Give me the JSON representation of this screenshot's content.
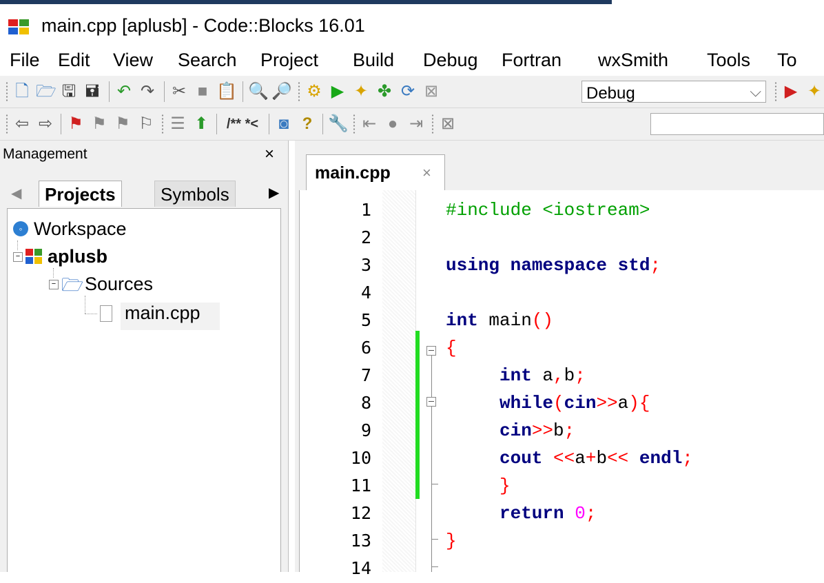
{
  "window": {
    "title": "main.cpp [aplusb] - Code::Blocks 16.01",
    "accent_color": "#1f3a5f"
  },
  "menubar": {
    "items": [
      "File",
      "Edit",
      "View",
      "Search",
      "Project",
      "Build",
      "Debug",
      "Fortran",
      "wxSmith",
      "Tools",
      "To"
    ]
  },
  "toolbar1": {
    "icons": [
      "new-file-icon",
      "open-icon",
      "save-icon",
      "save-all-icon",
      "undo-icon",
      "redo-icon",
      "cut-icon",
      "copy-icon",
      "paste-icon",
      "find-icon",
      "replace-icon",
      "build-icon",
      "run-icon",
      "build-and-run-icon",
      "rebuild-icon",
      "abort-icon"
    ],
    "build_target": "Debug",
    "debug_icons": [
      "debug-continue-icon"
    ]
  },
  "toolbar2": {
    "icons": [
      "jump-back-icon",
      "jump-forward-icon",
      "toggle-bookmark-icon",
      "prev-bookmark-icon",
      "next-bookmark-icon",
      "clear-bookmarks-icon",
      "highlight-icon",
      "match-icon"
    ],
    "doxygen_label": "/** *<",
    "search_value": ""
  },
  "management": {
    "title": "Management",
    "close": "×",
    "tabs": [
      "Projects",
      "Symbols"
    ],
    "active_tab": "Projects",
    "tree": {
      "workspace": "Workspace",
      "project": "aplusb",
      "folder": "Sources",
      "file": "main.cpp"
    }
  },
  "editor": {
    "tab_label": "main.cpp",
    "tab_close": "×",
    "line_numbers": [
      "1",
      "2",
      "3",
      "4",
      "5",
      "6",
      "7",
      "8",
      "9",
      "10",
      "11",
      "12",
      "13",
      "14"
    ],
    "code": {
      "l1": "#include <iostream>",
      "l3_kw": "using namespace std",
      "l3_end": ";",
      "l5_kw": "int",
      "l5_name": " main",
      "l5_paren": "()",
      "l6": "{",
      "l7_kw": "int",
      "l7_vars": " a",
      "l7_comma": ",",
      "l7_b": "b",
      "l7_semi": ";",
      "l8_kw": "while",
      "l8_open": "(",
      "l8_cin": "cin",
      "l8_shift": ">>",
      "l8_a": "a",
      "l8_close": "){",
      "l9_cin": "cin",
      "l9_shift": ">>",
      "l9_b": "b",
      "l9_semi": ";",
      "l10_cout": "cout ",
      "l10_op1": "<<",
      "l10_a": "a",
      "l10_plus": "+",
      "l10_b": "b",
      "l10_op2": "<<",
      "l10_endl": " endl",
      "l10_semi": ";",
      "l11": "}",
      "l12_kw": "return",
      "l12_num": " 0",
      "l12_semi": ";",
      "l13": "}"
    }
  }
}
